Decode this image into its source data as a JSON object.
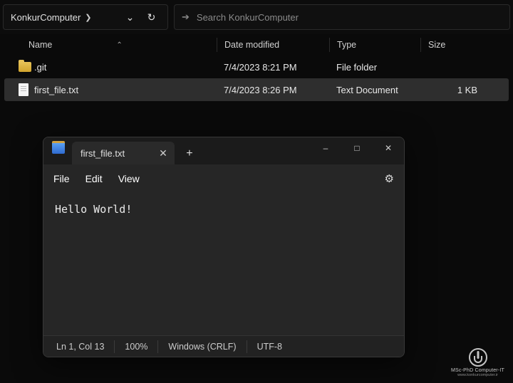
{
  "explorer": {
    "breadcrumb": "KonkurComputer",
    "search_placeholder": "Search KonkurComputer",
    "columns": {
      "name": "Name",
      "date": "Date modified",
      "type": "Type",
      "size": "Size"
    },
    "rows": [
      {
        "icon": "folder",
        "name": ".git",
        "date": "7/4/2023 8:21 PM",
        "type": "File folder",
        "size": "",
        "selected": false
      },
      {
        "icon": "file",
        "name": "first_file.txt",
        "date": "7/4/2023 8:26 PM",
        "type": "Text Document",
        "size": "1 KB",
        "selected": true
      }
    ]
  },
  "notepad": {
    "tab_title": "first_file.txt",
    "menus": {
      "file": "File",
      "edit": "Edit",
      "view": "View"
    },
    "content": "Hello World!",
    "status": {
      "pos": "Ln 1, Col 13",
      "zoom": "100%",
      "eol": "Windows (CRLF)",
      "encoding": "UTF-8"
    }
  },
  "watermark": {
    "line1": "MSc-PhD Computer-IT",
    "line2": "www.konkurcomputer.ir"
  }
}
